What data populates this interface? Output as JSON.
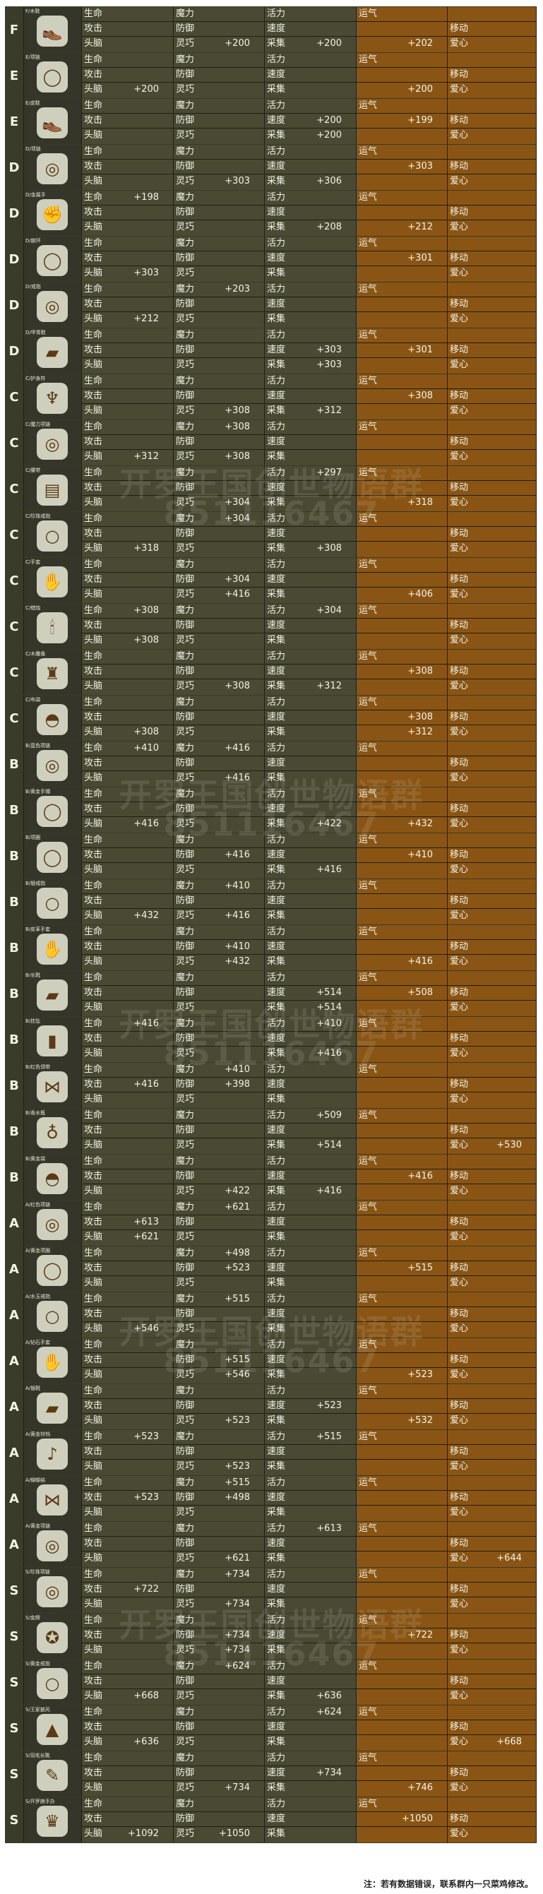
{
  "labels": [
    [
      "生命",
      "魔力",
      "活力",
      "运气",
      ""
    ],
    [
      "攻击",
      "防御",
      "速度",
      "",
      "移动"
    ],
    [
      "头脑",
      "灵巧",
      "采集",
      "",
      "爱心"
    ]
  ],
  "items": [
    {
      "rank": "F",
      "name": "F/木鞋",
      "icon": "wooden-shoe-icon",
      "vals": [
        [
          "",
          "",
          "",
          "",
          ""
        ],
        [
          "",
          "",
          "",
          "",
          ""
        ],
        [
          "",
          "+200",
          "+200",
          "+202",
          ""
        ]
      ]
    },
    {
      "rank": "E",
      "name": "E/项链",
      "icon": "necklace-icon",
      "vals": [
        [
          "",
          "",
          "",
          "",
          ""
        ],
        [
          "",
          "",
          "",
          "",
          ""
        ],
        [
          "+200",
          "",
          "",
          "+200",
          ""
        ]
      ]
    },
    {
      "rank": "E",
      "name": "E/皮鞋",
      "icon": "leather-shoe-icon",
      "vals": [
        [
          "",
          "",
          "",
          "",
          ""
        ],
        [
          "",
          "",
          "+200",
          "+199",
          ""
        ],
        [
          "",
          "",
          "+200",
          "",
          ""
        ]
      ]
    },
    {
      "rank": "D",
      "name": "D/项链",
      "icon": "pendant-icon",
      "vals": [
        [
          "",
          "",
          "",
          "",
          ""
        ],
        [
          "",
          "",
          "",
          "+303",
          ""
        ],
        [
          "",
          "+303",
          "+306",
          "",
          ""
        ]
      ]
    },
    {
      "rank": "D",
      "name": "D/金属手",
      "icon": "gauntlet-icon",
      "vals": [
        [
          "+198",
          "",
          "",
          "",
          ""
        ],
        [
          "",
          "",
          "",
          "",
          ""
        ],
        [
          "",
          "",
          "+208",
          "+212",
          ""
        ]
      ]
    },
    {
      "rank": "D",
      "name": "D/腕环",
      "icon": "bracelet-icon",
      "vals": [
        [
          "",
          "",
          "",
          "",
          ""
        ],
        [
          "",
          "",
          "",
          "+301",
          ""
        ],
        [
          "+303",
          "",
          "",
          "",
          ""
        ]
      ]
    },
    {
      "rank": "D",
      "name": "D/戒指",
      "icon": "ring-icon",
      "vals": [
        [
          "",
          "+203",
          "",
          "",
          ""
        ],
        [
          "",
          "",
          "",
          "",
          ""
        ],
        [
          "+212",
          "",
          "",
          "",
          ""
        ]
      ]
    },
    {
      "rank": "D",
      "name": "D/甲胄鞋",
      "icon": "armor-boot-icon",
      "vals": [
        [
          "",
          "",
          "",
          "",
          ""
        ],
        [
          "",
          "",
          "+303",
          "+301",
          ""
        ],
        [
          "",
          "",
          "+303",
          "",
          ""
        ]
      ]
    },
    {
      "rank": "C",
      "name": "C/护身符",
      "icon": "amulet-icon",
      "vals": [
        [
          "",
          "",
          "",
          "",
          ""
        ],
        [
          "",
          "",
          "",
          "+308",
          ""
        ],
        [
          "",
          "+308",
          "+312",
          "",
          ""
        ]
      ]
    },
    {
      "rank": "C",
      "name": "C/魔力项链",
      "icon": "magic-necklace-icon",
      "vals": [
        [
          "",
          "+308",
          "",
          "",
          ""
        ],
        [
          "",
          "",
          "",
          "",
          ""
        ],
        [
          "+312",
          "+308",
          "",
          "",
          ""
        ]
      ]
    },
    {
      "rank": "C",
      "name": "C/腰带",
      "icon": "belt-icon",
      "vals": [
        [
          "",
          "",
          "+297",
          "",
          ""
        ],
        [
          "",
          "",
          "",
          "",
          ""
        ],
        [
          "",
          "+304",
          "",
          "+318",
          ""
        ]
      ]
    },
    {
      "rank": "C",
      "name": "C/珍珠戒指",
      "icon": "pearl-ring-icon",
      "vals": [
        [
          "",
          "+304",
          "",
          "",
          ""
        ],
        [
          "",
          "",
          "",
          "",
          ""
        ],
        [
          "+318",
          "",
          "+308",
          "",
          ""
        ]
      ]
    },
    {
      "rank": "C",
      "name": "C/手套",
      "icon": "glove-icon",
      "vals": [
        [
          "",
          "",
          "",
          "",
          ""
        ],
        [
          "",
          "+304",
          "",
          "",
          ""
        ],
        [
          "",
          "+416",
          "",
          "+406",
          ""
        ]
      ]
    },
    {
      "rank": "C",
      "name": "C/蜡烛",
      "icon": "candle-icon",
      "vals": [
        [
          "+308",
          "",
          "+304",
          "",
          ""
        ],
        [
          "",
          "",
          "",
          "",
          ""
        ],
        [
          "+308",
          "",
          "",
          "",
          ""
        ]
      ]
    },
    {
      "rank": "C",
      "name": "C/木雕像",
      "icon": "statue-icon",
      "vals": [
        [
          "",
          "",
          "",
          "",
          ""
        ],
        [
          "",
          "",
          "",
          "+308",
          ""
        ],
        [
          "",
          "+308",
          "+312",
          "",
          ""
        ]
      ]
    },
    {
      "rank": "C",
      "name": "C/布袋",
      "icon": "bag-icon",
      "vals": [
        [
          "",
          "",
          "",
          "",
          ""
        ],
        [
          "",
          "",
          "",
          "+308",
          ""
        ],
        [
          "+308",
          "",
          "",
          "+312",
          ""
        ]
      ]
    },
    {
      "rank": "B",
      "name": "B/蓝色项链",
      "icon": "blue-necklace-icon",
      "vals": [
        [
          "+410",
          "+416",
          "",
          "",
          ""
        ],
        [
          "",
          "",
          "",
          "",
          ""
        ],
        [
          "",
          "+416",
          "",
          "",
          ""
        ]
      ]
    },
    {
      "rank": "B",
      "name": "B/黄金手镯",
      "icon": "gold-bangle-icon",
      "vals": [
        [
          "",
          "",
          "",
          "",
          ""
        ],
        [
          "",
          "",
          "",
          "",
          ""
        ],
        [
          "+416",
          "",
          "+422",
          "+432",
          ""
        ]
      ]
    },
    {
      "rank": "B",
      "name": "B/项圈",
      "icon": "collar-icon",
      "vals": [
        [
          "",
          "",
          "",
          "",
          ""
        ],
        [
          "",
          "+416",
          "",
          "+410",
          ""
        ],
        [
          "",
          "",
          "+416",
          "",
          ""
        ]
      ]
    },
    {
      "rank": "B",
      "name": "B/银戒指",
      "icon": "silver-ring-icon",
      "vals": [
        [
          "",
          "+410",
          "",
          "",
          ""
        ],
        [
          "",
          "",
          "",
          "",
          ""
        ],
        [
          "+432",
          "+416",
          "",
          "",
          ""
        ]
      ]
    },
    {
      "rank": "B",
      "name": "B/皮革手套",
      "icon": "leather-glove-icon",
      "vals": [
        [
          "",
          "",
          "",
          "",
          ""
        ],
        [
          "",
          "+410",
          "",
          "",
          ""
        ],
        [
          "",
          "+432",
          "",
          "+416",
          ""
        ]
      ]
    },
    {
      "rank": "B",
      "name": "B/长靴",
      "icon": "long-boot-icon",
      "vals": [
        [
          "",
          "",
          "",
          "",
          ""
        ],
        [
          "",
          "",
          "+514",
          "+508",
          ""
        ],
        [
          "",
          "",
          "+514",
          "",
          ""
        ]
      ]
    },
    {
      "rank": "B",
      "name": "B/挂坠",
      "icon": "charm-icon",
      "vals": [
        [
          "+416",
          "",
          "+410",
          "",
          ""
        ],
        [
          "",
          "",
          "",
          "",
          ""
        ],
        [
          "",
          "",
          "+416",
          "",
          ""
        ]
      ]
    },
    {
      "rank": "B",
      "name": "B/红色领带",
      "icon": "red-tie-icon",
      "vals": [
        [
          "",
          "+410",
          "",
          "",
          ""
        ],
        [
          "+416",
          "+398",
          "",
          "",
          ""
        ],
        [
          "",
          "",
          "",
          "",
          ""
        ]
      ]
    },
    {
      "rank": "B",
      "name": "B/香水瓶",
      "icon": "perfume-icon",
      "vals": [
        [
          "",
          "",
          "+509",
          "",
          ""
        ],
        [
          "",
          "",
          "",
          "",
          ""
        ],
        [
          "",
          "",
          "+514",
          "",
          "+530"
        ]
      ]
    },
    {
      "rank": "B",
      "name": "B/黄金袋",
      "icon": "gold-bag-icon",
      "vals": [
        [
          "",
          "",
          "",
          "",
          ""
        ],
        [
          "",
          "",
          "",
          "+416",
          ""
        ],
        [
          "",
          "+422",
          "+416",
          "",
          ""
        ]
      ]
    },
    {
      "rank": "A",
      "name": "A/红色项链",
      "icon": "ruby-necklace-icon",
      "vals": [
        [
          "",
          "+621",
          "",
          "",
          ""
        ],
        [
          "+613",
          "",
          "",
          "",
          ""
        ],
        [
          "+621",
          "",
          "",
          "",
          ""
        ]
      ]
    },
    {
      "rank": "A",
      "name": "A/黄金项圈",
      "icon": "gold-collar-icon",
      "vals": [
        [
          "",
          "+498",
          "",
          "",
          ""
        ],
        [
          "",
          "+523",
          "",
          "+515",
          ""
        ],
        [
          "",
          "",
          "",
          "",
          ""
        ]
      ]
    },
    {
      "rank": "A",
      "name": "A/水玉戒指",
      "icon": "jade-ring-icon",
      "vals": [
        [
          "",
          "+515",
          "",
          "",
          ""
        ],
        [
          "",
          "",
          "",
          "",
          ""
        ],
        [
          "+546",
          "",
          "",
          "",
          ""
        ]
      ]
    },
    {
      "rank": "A",
      "name": "A/钻石手套",
      "icon": "diamond-glove-icon",
      "vals": [
        [
          "",
          "",
          "",
          "",
          ""
        ],
        [
          "",
          "+515",
          "",
          "",
          ""
        ],
        [
          "",
          "+546",
          "",
          "+523",
          ""
        ]
      ]
    },
    {
      "rank": "A",
      "name": "A/银靴",
      "icon": "silver-boot-icon",
      "vals": [
        [
          "",
          "",
          "",
          "",
          ""
        ],
        [
          "",
          "",
          "+523",
          "",
          ""
        ],
        [
          "",
          "+523",
          "",
          "+532",
          ""
        ]
      ]
    },
    {
      "rank": "A",
      "name": "A/黄金铃铛",
      "icon": "gold-bell-icon",
      "vals": [
        [
          "+523",
          "",
          "+515",
          "",
          ""
        ],
        [
          "",
          "",
          "",
          "",
          ""
        ],
        [
          "",
          "+523",
          "",
          "",
          ""
        ]
      ]
    },
    {
      "rank": "A",
      "name": "A/蝴蝶结",
      "icon": "ribbon-icon",
      "vals": [
        [
          "",
          "+515",
          "",
          "",
          ""
        ],
        [
          "+523",
          "+498",
          "",
          "",
          ""
        ],
        [
          "",
          "",
          "",
          "",
          ""
        ]
      ]
    },
    {
      "rank": "A",
      "name": "A/黄金项链",
      "icon": "gold-necklace-icon",
      "vals": [
        [
          "",
          "",
          "+613",
          "",
          ""
        ],
        [
          "",
          "",
          "",
          "",
          ""
        ],
        [
          "",
          "+621",
          "",
          "",
          "+644"
        ]
      ]
    },
    {
      "rank": "S",
      "name": "S/珍珠项链",
      "icon": "pearl-necklace-icon",
      "vals": [
        [
          "",
          "+734",
          "",
          "",
          ""
        ],
        [
          "+722",
          "",
          "",
          "",
          ""
        ],
        [
          "",
          "+734",
          "",
          "",
          ""
        ]
      ]
    },
    {
      "rank": "S",
      "name": "S/金牌",
      "icon": "gold-medal-icon",
      "vals": [
        [
          "",
          "",
          "",
          "",
          ""
        ],
        [
          "",
          "+734",
          "",
          "+722",
          ""
        ],
        [
          "",
          "+734",
          "",
          "",
          ""
        ]
      ]
    },
    {
      "rank": "S",
      "name": "S/黄金戒指",
      "icon": "gold-ring-icon",
      "vals": [
        [
          "",
          "+624",
          "",
          "",
          ""
        ],
        [
          "",
          "",
          "",
          "",
          ""
        ],
        [
          "+668",
          "",
          "+636",
          "",
          ""
        ]
      ]
    },
    {
      "rank": "S",
      "name": "S/王家披风",
      "icon": "royal-cape-icon",
      "vals": [
        [
          "",
          "",
          "+624",
          "",
          ""
        ],
        [
          "",
          "",
          "",
          "",
          ""
        ],
        [
          "+636",
          "",
          "",
          "",
          "+668"
        ]
      ]
    },
    {
      "rank": "S",
      "name": "S/羽毛长靴",
      "icon": "feather-boot-icon",
      "vals": [
        [
          "",
          "",
          "",
          "",
          ""
        ],
        [
          "",
          "",
          "+734",
          "",
          ""
        ],
        [
          "",
          "+734",
          "",
          "+746",
          ""
        ]
      ]
    },
    {
      "rank": "S",
      "name": "S/开罗娘手办",
      "icon": "figure-icon",
      "vals": [
        [
          "",
          "",
          "",
          "",
          ""
        ],
        [
          "",
          "",
          "",
          "+1050",
          ""
        ],
        [
          "+1092",
          "+1050",
          "",
          "",
          ""
        ]
      ]
    }
  ],
  "watermark": {
    "line1": "开罗王国创世物语群",
    "line2": "851116467"
  },
  "footnote": "注：若有数据错误，联系群内一只菜鸡修改。"
}
